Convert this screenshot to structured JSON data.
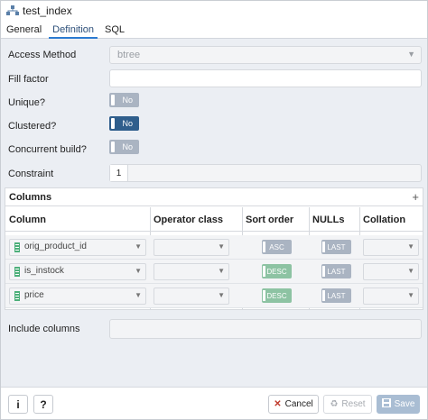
{
  "window": {
    "title": "test_index",
    "title_icon": "index-icon"
  },
  "tabs": [
    {
      "label": "General"
    },
    {
      "label": "Definition"
    },
    {
      "label": "SQL"
    }
  ],
  "form": {
    "access_method": {
      "label": "Access Method",
      "value": "btree"
    },
    "fill_factor": {
      "label": "Fill factor",
      "value": ""
    },
    "unique": {
      "label": "Unique?",
      "state": "No"
    },
    "clustered": {
      "label": "Clustered?",
      "state": "No"
    },
    "concurrent_build": {
      "label": "Concurrent build?",
      "state": "No"
    },
    "constraint": {
      "label": "Constraint",
      "tab_number": "1"
    },
    "include_columns": {
      "label": "Include columns",
      "value": ""
    }
  },
  "columns_panel": {
    "title": "Columns",
    "add_icon": "+",
    "headers": [
      "Column",
      "Operator class",
      "Sort order",
      "NULLs",
      "Collation"
    ],
    "rows": [
      {
        "column": "orig_product_id",
        "operator_class": "",
        "sort_order": "ASC",
        "nulls": "LAST",
        "collation": ""
      },
      {
        "column": "is_instock",
        "operator_class": "",
        "sort_order": "DESC",
        "nulls": "LAST",
        "collation": ""
      },
      {
        "column": "price",
        "operator_class": "",
        "sort_order": "DESC",
        "nulls": "LAST",
        "collation": ""
      }
    ]
  },
  "footer": {
    "info_label": "i",
    "help_label": "?",
    "cancel_label": "Cancel",
    "reset_label": "Reset",
    "save_label": "Save"
  },
  "colors": {
    "toggle_dark": "#2f5e8c",
    "toggle_light": "#aab4c2",
    "toggle_desc": "#8dc3a3",
    "save_disabled": "#a9bdd3",
    "cancel_icon": "#c0392b",
    "tab_active": "#2c7bd1"
  }
}
